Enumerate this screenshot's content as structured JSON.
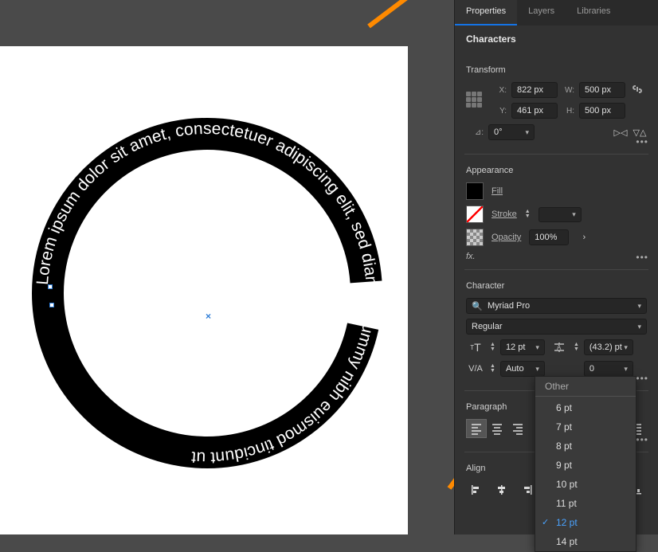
{
  "tabs": {
    "properties": "Properties",
    "layers": "Layers",
    "libraries": "Libraries"
  },
  "section_characters": "Characters",
  "transform": {
    "title": "Transform",
    "x_label": "X:",
    "x_value": "822 px",
    "y_label": "Y:",
    "y_value": "461 px",
    "w_label": "W:",
    "w_value": "500 px",
    "h_label": "H:",
    "h_value": "500 px",
    "angle_label": "⊿:",
    "angle_value": "0°"
  },
  "appearance": {
    "title": "Appearance",
    "fill": "Fill",
    "stroke": "Stroke",
    "opacity": "Opacity",
    "opacity_value": "100%",
    "fx": "fx."
  },
  "character": {
    "title": "Character",
    "font_family": "Myriad Pro",
    "font_style": "Regular",
    "size_value": "12 pt",
    "leading_value": "(43.2) pt",
    "kerning_value": "Auto",
    "tracking_value": "0"
  },
  "font_size_list": {
    "header": "Other",
    "items": [
      "6 pt",
      "7 pt",
      "8 pt",
      "9 pt",
      "10 pt",
      "11 pt",
      "12 pt",
      "14 pt"
    ],
    "selected": "12 pt"
  },
  "paragraph": {
    "title": "Paragraph"
  },
  "align": {
    "title": "Align"
  },
  "path_text": "Lorem ipsum dolor sit amet, consectetuer adipiscing elit, sed diam nonummy nibh euismod tincidunt ut"
}
